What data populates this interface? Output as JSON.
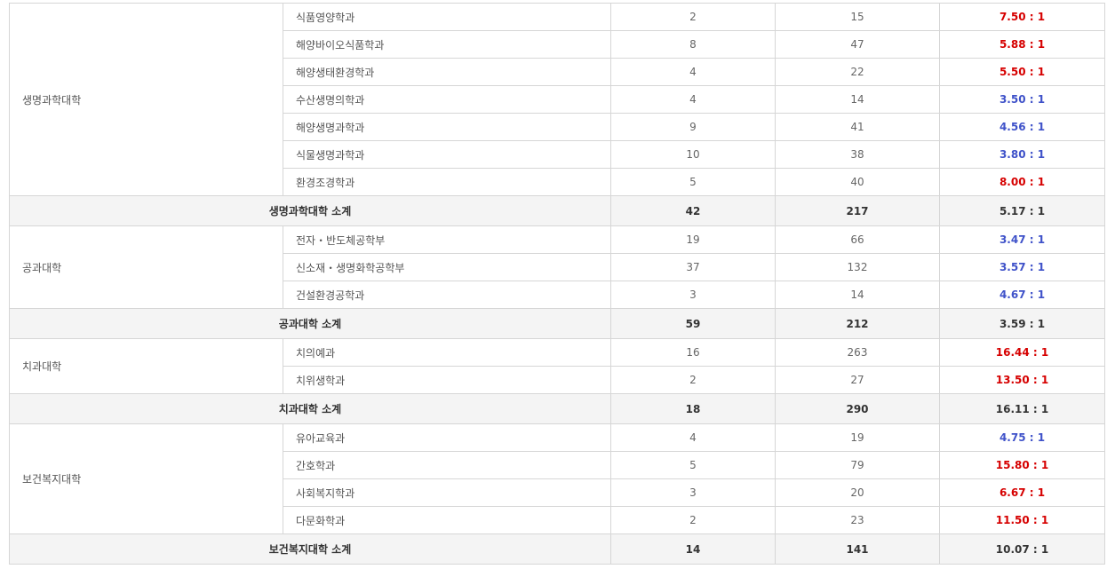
{
  "colors": {
    "high_ratio": "#d60000",
    "low_ratio": "#3f52c9"
  },
  "groups": [
    {
      "college": "생명과학대학",
      "rows": [
        {
          "dept": "식품영양학과",
          "quota": "2",
          "applicants": "15",
          "ratio": "7.50 : 1",
          "tone": "hi"
        },
        {
          "dept": "해양바이오식품학과",
          "quota": "8",
          "applicants": "47",
          "ratio": "5.88 : 1",
          "tone": "hi"
        },
        {
          "dept": "해양생태환경학과",
          "quota": "4",
          "applicants": "22",
          "ratio": "5.50 : 1",
          "tone": "hi"
        },
        {
          "dept": "수산생명의학과",
          "quota": "4",
          "applicants": "14",
          "ratio": "3.50 : 1",
          "tone": "lo"
        },
        {
          "dept": "해양생명과학과",
          "quota": "9",
          "applicants": "41",
          "ratio": "4.56 : 1",
          "tone": "lo"
        },
        {
          "dept": "식물생명과학과",
          "quota": "10",
          "applicants": "38",
          "ratio": "3.80 : 1",
          "tone": "lo"
        },
        {
          "dept": "환경조경학과",
          "quota": "5",
          "applicants": "40",
          "ratio": "8.00 : 1",
          "tone": "hi"
        }
      ],
      "subtotal": {
        "label": "생명과학대학 소계",
        "quota": "42",
        "applicants": "217",
        "ratio": "5.17 : 1",
        "tone": "hi"
      }
    },
    {
      "college": "공과대학",
      "rows": [
        {
          "dept": "전자・반도체공학부",
          "quota": "19",
          "applicants": "66",
          "ratio": "3.47 : 1",
          "tone": "lo"
        },
        {
          "dept": "신소재・생명화학공학부",
          "quota": "37",
          "applicants": "132",
          "ratio": "3.57 : 1",
          "tone": "lo"
        },
        {
          "dept": "건설환경공학과",
          "quota": "3",
          "applicants": "14",
          "ratio": "4.67 : 1",
          "tone": "lo"
        }
      ],
      "subtotal": {
        "label": "공과대학 소계",
        "quota": "59",
        "applicants": "212",
        "ratio": "3.59 : 1",
        "tone": "lo"
      }
    },
    {
      "college": "치과대학",
      "rows": [
        {
          "dept": "치의예과",
          "quota": "16",
          "applicants": "263",
          "ratio": "16.44 : 1",
          "tone": "hi"
        },
        {
          "dept": "치위생학과",
          "quota": "2",
          "applicants": "27",
          "ratio": "13.50 : 1",
          "tone": "hi"
        }
      ],
      "subtotal": {
        "label": "치과대학 소계",
        "quota": "18",
        "applicants": "290",
        "ratio": "16.11 : 1",
        "tone": "hi"
      }
    },
    {
      "college": "보건복지대학",
      "rows": [
        {
          "dept": "유아교육과",
          "quota": "4",
          "applicants": "19",
          "ratio": "4.75 : 1",
          "tone": "lo"
        },
        {
          "dept": "간호학과",
          "quota": "5",
          "applicants": "79",
          "ratio": "15.80 : 1",
          "tone": "hi"
        },
        {
          "dept": "사회복지학과",
          "quota": "3",
          "applicants": "20",
          "ratio": "6.67 : 1",
          "tone": "hi"
        },
        {
          "dept": "다문화학과",
          "quota": "2",
          "applicants": "23",
          "ratio": "11.50 : 1",
          "tone": "hi"
        }
      ],
      "subtotal": {
        "label": "보건복지대학 소계",
        "quota": "14",
        "applicants": "141",
        "ratio": "10.07 : 1",
        "tone": "hi"
      }
    }
  ]
}
